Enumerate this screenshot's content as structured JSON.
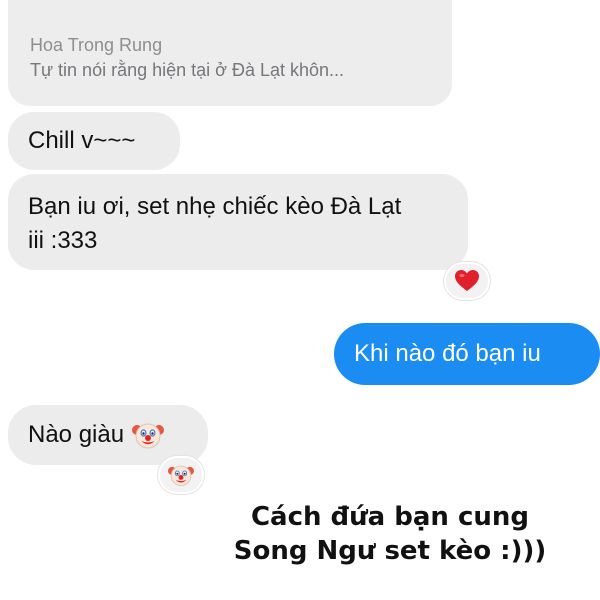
{
  "chat": {
    "quoted": {
      "name": "Hoa Trong Rung",
      "text": "Tự tin nói rằng hiện tại ở Đà Lạt khôn..."
    },
    "messages": [
      {
        "sender": "friend",
        "text": "Chill v~~~"
      },
      {
        "sender": "friend",
        "lines": [
          "Bạn iu ơi, set nhẹ chiếc kèo Đà Lạt",
          "iii :333"
        ],
        "reaction": "heart-icon"
      },
      {
        "sender": "me",
        "text": "Khi nào đó bạn iu"
      },
      {
        "sender": "friend",
        "text": "Nào giàu",
        "emoji": "clown-face-icon",
        "reaction": "clown-face-icon"
      }
    ]
  },
  "caption": {
    "line1": "Cách đứa bạn cung",
    "line2": "Song Ngư set kèo :)))"
  },
  "colors": {
    "received_bubble": "#ececec",
    "sent_bubble": "#1b8cf2",
    "quote_text": "#8e8e93",
    "heart": "#e0202a"
  }
}
